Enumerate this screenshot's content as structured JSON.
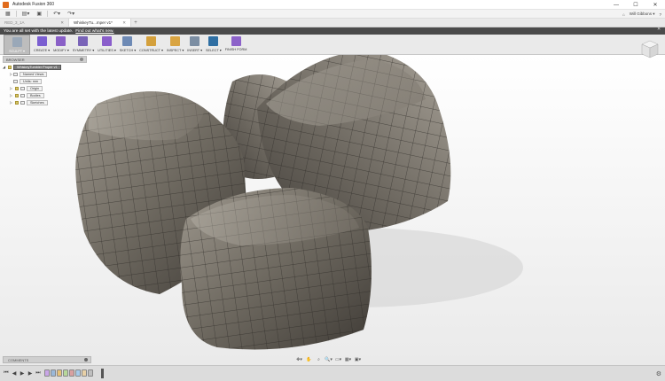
{
  "app": {
    "title": "Autodesk Fusion 360"
  },
  "window_controls": {
    "minimize": "—",
    "maximize": "☐",
    "close": "✕"
  },
  "quick_access": {
    "grid_icon": "grid-icon",
    "file_label": "▾",
    "save_icon": "save-icon",
    "undo_label": "↶▾",
    "redo_label": "↷▾",
    "user": "Will Gibbons ▾",
    "help": "?",
    "jobs": "⌂"
  },
  "tabs": [
    {
      "label": "RED_3_1A",
      "active": false
    },
    {
      "label": "WhiskeyTu...mper v1*",
      "active": true
    }
  ],
  "banner": {
    "text": "You are all set with the latest update.",
    "link": "Find out what's new.",
    "close": "✕"
  },
  "toolbar": [
    {
      "label": "SCULPT ▾",
      "icon": "sculpt-icon",
      "color": "#9aa8b8",
      "active": true
    },
    {
      "label": "CREATE ▾",
      "icon": "create-icon",
      "color": "#7b5fd1"
    },
    {
      "label": "MODIFY ▾",
      "icon": "modify-icon",
      "color": "#8a60c7"
    },
    {
      "label": "SYMMETRY ▾",
      "icon": "symmetry-icon",
      "color": "#7a64b8"
    },
    {
      "label": "UTILITIES ▾",
      "icon": "utilities-icon",
      "color": "#8a5ecb"
    },
    {
      "label": "SKETCH ▾",
      "icon": "sketch-icon",
      "color": "#6e8ab5"
    },
    {
      "label": "CONSTRUCT ▾",
      "icon": "construct-icon",
      "color": "#d4a03c"
    },
    {
      "label": "INSPECT ▾",
      "icon": "inspect-icon",
      "color": "#d9a441"
    },
    {
      "label": "INSERT ▾",
      "icon": "insert-icon",
      "color": "#7c8ea3"
    },
    {
      "label": "SELECT ▾",
      "icon": "select-icon",
      "color": "#2f6fa3"
    },
    {
      "label": "FINISH FORM",
      "icon": "finish-form-icon",
      "color": "#8c62c9"
    }
  ],
  "browser": {
    "title": "BROWSER",
    "root": "WhiskeyTumbler Proper v1",
    "items": [
      "Named Views",
      "Units: mm",
      "Origin",
      "Bodies",
      "Sketches"
    ]
  },
  "comments": {
    "label": "COMMENTS",
    "plus": "+"
  },
  "navbar": [
    "✥▾",
    "✋",
    "⌕",
    "🔍▾",
    "▭▾",
    "▦▾",
    "▣▾"
  ],
  "timeline": {
    "controls": [
      "⏮",
      "◀",
      "▶",
      "▶",
      "⏭"
    ],
    "items": 8,
    "gear": "⚙"
  },
  "colors": {
    "banner": "#4b4b4b",
    "model": "#6f6a63",
    "accent": "#e06b1c"
  }
}
